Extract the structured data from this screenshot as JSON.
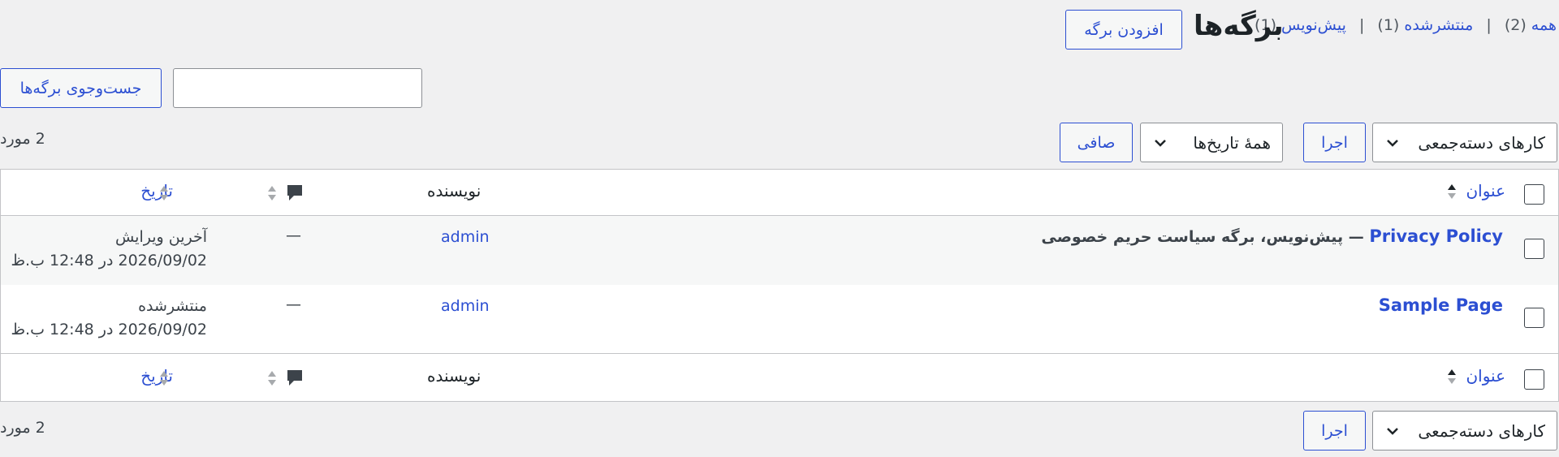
{
  "views": {
    "all_label": "همه",
    "all_count": "(2)",
    "published_label": "منتشرشده",
    "published_count": "(1)",
    "draft_label": "پیش‌نویس",
    "draft_count": "(1)",
    "separator": "|"
  },
  "header": {
    "title": "برگه‌ها",
    "add_new_label": "افزودن برگه"
  },
  "search": {
    "value": "",
    "button_label": "جست‌وجوی برگه‌ها"
  },
  "toolbar_top": {
    "bulk_actions": "کارهای دسته‌جمعی",
    "apply_label": "اجرا",
    "dates_filter": "همهٔ تاریخ‌ها",
    "filter_label": "صافی",
    "items_count": "2 مورد"
  },
  "table": {
    "columns": {
      "title": "عنوان",
      "author": "نویسنده",
      "comments_icon": "comment-bubble-icon",
      "date": "تاریخ"
    },
    "rows": [
      {
        "title": "Privacy Policy",
        "state": " — پیش‌نویس، برگه سیاست حریم خصوصی",
        "author": "admin",
        "comments": "—",
        "date_status": "آخرین ویرایش",
        "date_value": "2026/09/02 در 12:48 ب.ظ"
      },
      {
        "title": "Sample Page",
        "state": "",
        "author": "admin",
        "comments": "—",
        "date_status": "منتشرشده",
        "date_value": "2026/09/02 در 12:48 ب.ظ"
      }
    ]
  },
  "toolbar_bottom": {
    "bulk_actions": "کارهای دسته‌جمعی",
    "apply_label": "اجرا",
    "items_count": "2 مورد"
  },
  "colors": {
    "link": "#2c4fd2",
    "background": "#f0f0f1",
    "border": "#c3c4c7"
  }
}
